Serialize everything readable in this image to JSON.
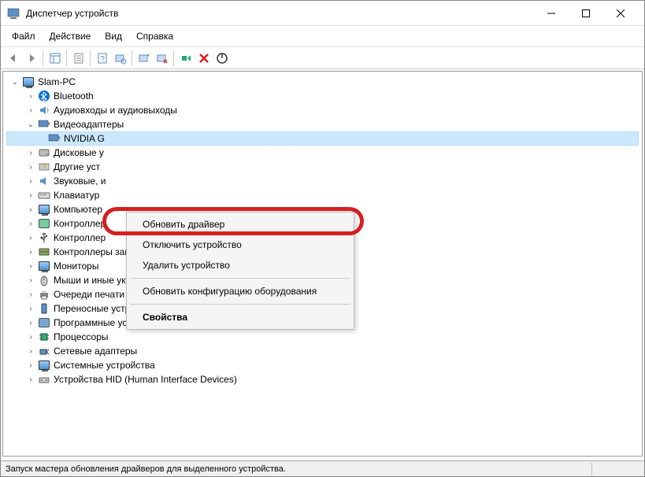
{
  "window": {
    "title": "Диспетчер устройств"
  },
  "menu": {
    "file": "Файл",
    "action": "Действие",
    "view": "Вид",
    "help": "Справка"
  },
  "tree": {
    "root": "Slam-PC",
    "bluetooth": "Bluetooth",
    "audio": "Аудиовходы и аудиовыходы",
    "video": "Видеоадаптеры",
    "nvidia": "NVIDIA G",
    "disk": "Дисковые у",
    "other": "Другие уст",
    "sound": "Звуковые, и",
    "keyboards": "Клавиатур",
    "computer": "Компьютер",
    "controllers1": "Контроллер",
    "controllers2": "Контроллер",
    "storage": "Контроллеры запоминающих устройств",
    "monitors": "Мониторы",
    "mice": "Мыши и иные указывающие устройства",
    "print": "Очереди печати",
    "portable": "Переносные устройства",
    "software": "Программные устройства",
    "processors": "Процессоры",
    "network": "Сетевые адаптеры",
    "system": "Системные устройства",
    "hid": "Устройства HID (Human Interface Devices)"
  },
  "context_menu": {
    "update_driver": "Обновить драйвер",
    "disable": "Отключить устройство",
    "uninstall": "Удалить устройство",
    "scan": "Обновить конфигурацию оборудования",
    "properties": "Свойства"
  },
  "status": {
    "text": "Запуск мастера обновления драйверов для выделенного устройства."
  }
}
